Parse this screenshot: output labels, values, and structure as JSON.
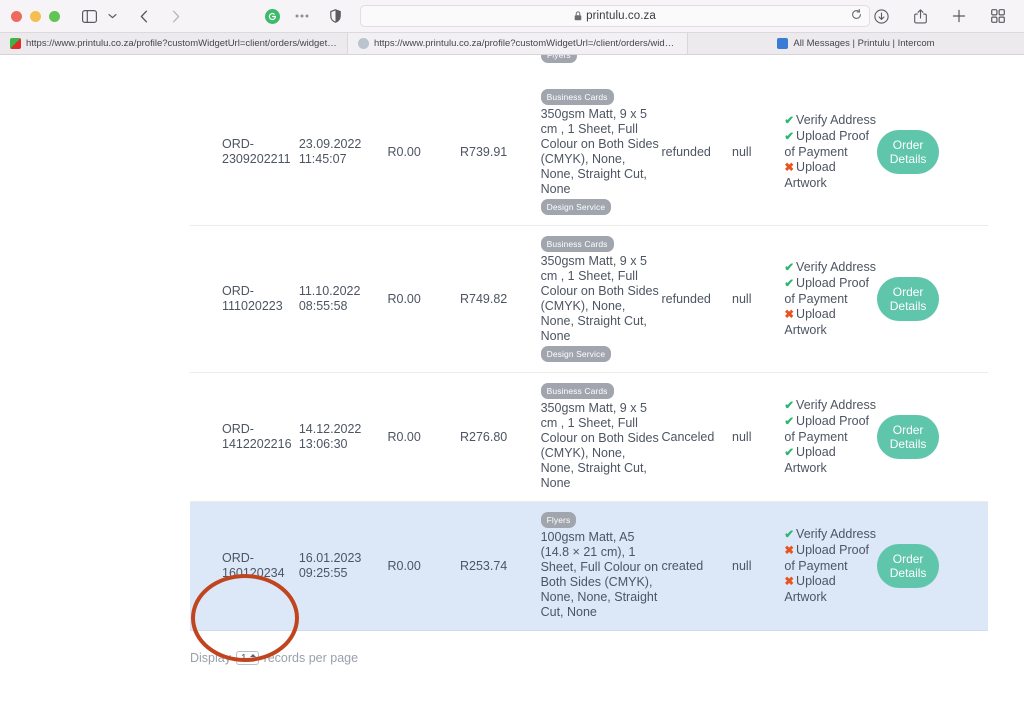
{
  "browser": {
    "url": "printulu.co.za",
    "url_lock_icon": "lock-icon",
    "reload_icon": "reload-icon",
    "back_icon": "back-chevron-icon",
    "forward_icon": "forward-chevron-icon",
    "sidebar_icon": "sidebar-toggle-icon",
    "sidebar_chevron_icon": "chevron-down-icon",
    "extension_icon": "extension-grammarly-icon",
    "more_icon": "more-dots-icon",
    "shield_icon": "privacy-shield-icon",
    "download_icon": "download-icon",
    "share_icon": "share-icon",
    "newtab_icon": "new-tab-plus-icon",
    "taboverview_icon": "tab-overview-icon",
    "tabs": [
      {
        "label": "https://www.printulu.co.za/profile?customWidgetUrl=client/orders/widgetDisplay",
        "favicon": "printulu-favicon",
        "active": false
      },
      {
        "label": "https://www.printulu.co.za/profile?customWidgetUrl=/client/orders/widgetOrderedPositions?...",
        "favicon": "globe-favicon",
        "active": true
      },
      {
        "label": "All Messages | Printulu | Intercom",
        "favicon": "intercom-favicon",
        "active": false
      }
    ]
  },
  "colors": {
    "button_teal": "#5fc5ab",
    "tag_gray": "#a0a5ae",
    "row_highlight": "#dce7f7",
    "check_green": "#2bb673",
    "cross_red": "#e8541f",
    "annotation_red": "#c0451f"
  },
  "table": {
    "cut_tag_label": "Flyers",
    "rows": [
      {
        "order_id": "ORD-2309202211",
        "date": "23.09.2022",
        "time": "11:45:07",
        "amount_paid": "R0.00",
        "amount_total": "R739.91",
        "product_tag": "Business Cards",
        "description": "350gsm Matt, 9 x 5 cm , 1 Sheet, Full Colour on Both Sides (CMYK), None, None, Straight Cut, None",
        "service_tag": "Design Service",
        "status": "refunded",
        "tracking": "null",
        "steps": [
          {
            "label": "Verify Address",
            "state": "ok"
          },
          {
            "label": "Upload Proof of Payment",
            "state": "ok"
          },
          {
            "label": "Upload Artwork",
            "state": "no"
          }
        ],
        "button_label": "Order Details",
        "highlighted": false
      },
      {
        "order_id": "ORD-111020223",
        "date": "11.10.2022",
        "time": "08:55:58",
        "amount_paid": "R0.00",
        "amount_total": "R749.82",
        "product_tag": "Business Cards",
        "description": "350gsm Matt, 9 x 5 cm , 1 Sheet, Full Colour on Both Sides (CMYK), None, None, Straight Cut, None",
        "service_tag": "Design Service",
        "status": "refunded",
        "tracking": "null",
        "steps": [
          {
            "label": "Verify Address",
            "state": "ok"
          },
          {
            "label": "Upload Proof of Payment",
            "state": "ok"
          },
          {
            "label": "Upload Artwork",
            "state": "no"
          }
        ],
        "button_label": "Order Details",
        "highlighted": false
      },
      {
        "order_id": "ORD-1412202216",
        "date": "14.12.2022",
        "time": "13:06:30",
        "amount_paid": "R0.00",
        "amount_total": "R276.80",
        "product_tag": "Business Cards",
        "description": "350gsm Matt, 9 x 5 cm , 1 Sheet, Full Colour on Both Sides (CMYK), None, None, Straight Cut, None",
        "service_tag": "",
        "status": "Canceled",
        "tracking": "null",
        "steps": [
          {
            "label": "Verify Address",
            "state": "ok"
          },
          {
            "label": "Upload Proof of Payment",
            "state": "ok"
          },
          {
            "label": "Upload Artwork",
            "state": "ok"
          }
        ],
        "button_label": "Order Details",
        "highlighted": false
      },
      {
        "order_id": "ORD-160120234",
        "date": "16.01.2023",
        "time": "09:25:55",
        "amount_paid": "R0.00",
        "amount_total": "R253.74",
        "product_tag": "Flyers",
        "description": "100gsm Matt, A5 (14.8 × 21 cm), 1 Sheet, Full Colour on Both Sides (CMYK), None, None, Straight Cut, None",
        "service_tag": "",
        "status": "created",
        "tracking": "null",
        "steps": [
          {
            "label": "Verify Address",
            "state": "ok"
          },
          {
            "label": "Upload Proof of Payment",
            "state": "no"
          },
          {
            "label": "Upload Artwork",
            "state": "no"
          }
        ],
        "button_label": "Order Details",
        "highlighted": true
      }
    ]
  },
  "footer": {
    "display_label": "Display",
    "records_value": "1",
    "records_label": "records per page"
  }
}
